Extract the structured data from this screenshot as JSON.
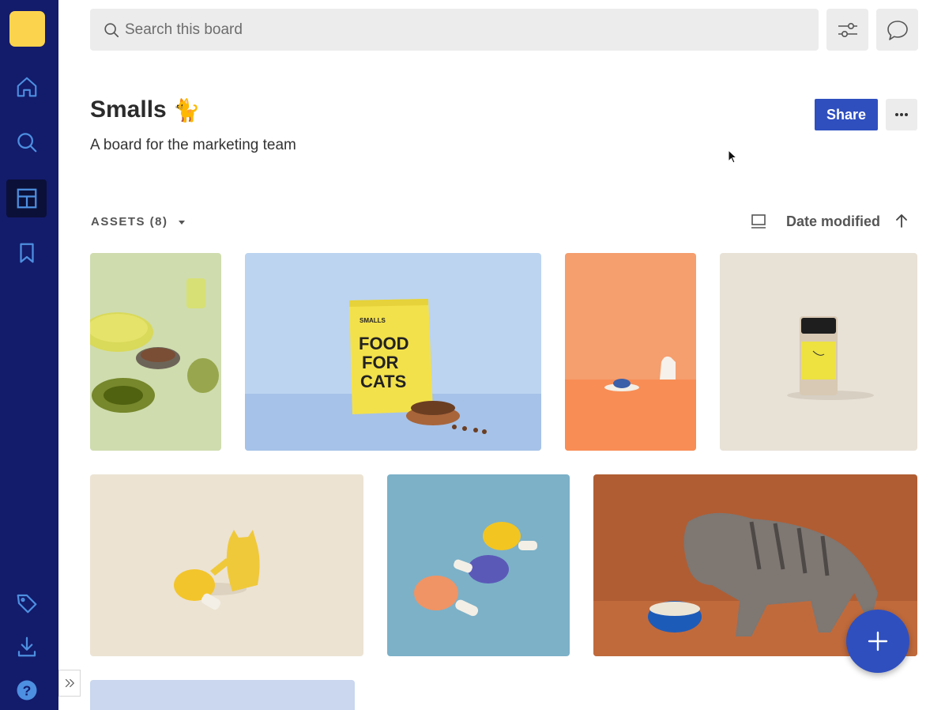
{
  "sidebar": {
    "logo_color": "#fcd34d",
    "background": "#131b6b",
    "items": [
      {
        "name": "home",
        "icon": "home-icon"
      },
      {
        "name": "search",
        "icon": "search-icon"
      },
      {
        "name": "boards",
        "icon": "board-layout-icon",
        "active": true
      },
      {
        "name": "saved",
        "icon": "bookmark-icon"
      },
      {
        "name": "tags",
        "icon": "tag-icon"
      },
      {
        "name": "downloads",
        "icon": "download-icon"
      },
      {
        "name": "help",
        "icon": "help-icon"
      }
    ],
    "expand_icon": "double-chevron-right-icon"
  },
  "topbar": {
    "search_placeholder": "Search this board",
    "filter_icon": "sliders-icon",
    "comments_icon": "chat-bubble-icon"
  },
  "board": {
    "title": "Smalls",
    "title_emoji": "🐈",
    "description": "A board for the marketing team",
    "share_label": "Share",
    "more_icon": "ellipsis-icon"
  },
  "assets": {
    "label": "ASSETS (8)",
    "view_icon": "monitor-icon",
    "sort_label": "Date modified",
    "sort_direction_icon": "arrow-up-icon",
    "items": [
      {
        "subject": "cat bowls on green backdrop"
      },
      {
        "subject": "SMALLS FOOD FOR CATS bag"
      },
      {
        "subject": "cat paw on orange backdrop"
      },
      {
        "subject": "cat food jar on beige backdrop"
      },
      {
        "subject": "crochet cat toy with drumstick"
      },
      {
        "subject": "crochet drumstick toys on blue"
      },
      {
        "subject": "kitten eating from blue bowl"
      },
      {
        "subject": "partially visible blue asset"
      }
    ]
  },
  "accent_color": "#2f4fbf",
  "fab_icon": "plus-icon"
}
